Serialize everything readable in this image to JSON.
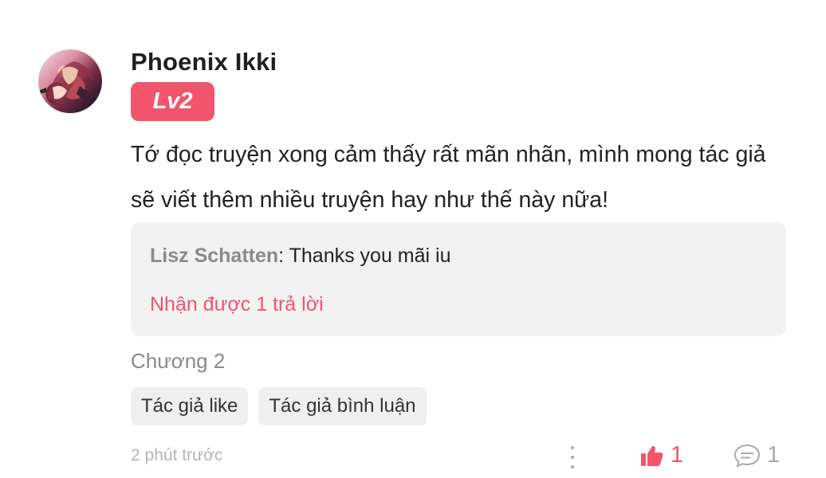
{
  "comment": {
    "username": "Phoenix Ikki",
    "level": "Lv2",
    "text": "Tớ đọc truyện xong cảm thấy rất mãn nhãn, mình mong tác giả sẽ viết thêm nhiều truyện hay như thế này nữa!",
    "chapter": "Chương 2",
    "timestamp": "2 phút trước",
    "likes": "1",
    "replies": "1"
  },
  "reply_preview": {
    "author": "Lisz Schatten",
    "separator": ": ",
    "text": "Thanks you mãi iu",
    "count_label": "Nhận được 1 trả lời"
  },
  "tags": [
    {
      "label": "Tác giả like"
    },
    {
      "label": "Tác giả bình luận"
    }
  ],
  "icons": {
    "more": "more-vertical-icon",
    "like": "thumbs-up-icon",
    "reply": "comment-bubble-icon"
  },
  "colors": {
    "accent": "#f2546e",
    "muted": "#8a8a8a",
    "reply_bg": "#f2f2f2"
  }
}
